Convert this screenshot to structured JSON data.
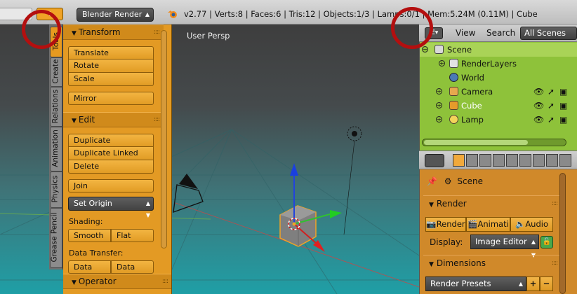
{
  "topbar": {
    "render_engine": "Blender Render",
    "stats": "v2.77 | Verts:8 | Faces:6 | Tris:12 | Objects:1/3 | Lamps:0/1 | Mem:5.24M (0.11M) | Cube",
    "add_label": "+"
  },
  "viewport": {
    "view_label": "User Persp"
  },
  "tool_tabs": [
    "Tools",
    "Create",
    "Relations",
    "Animation",
    "Physics",
    "Grease Pencil"
  ],
  "tool_panel": {
    "transform_header": "Transform",
    "transform_buttons": [
      "Translate",
      "Rotate",
      "Scale"
    ],
    "mirror": "Mirror",
    "edit_header": "Edit",
    "edit_buttons": [
      "Duplicate",
      "Duplicate Linked",
      "Delete"
    ],
    "join": "Join",
    "set_origin": "Set Origin",
    "shading_label": "Shading:",
    "smooth": "Smooth",
    "flat": "Flat",
    "data_transfer_label": "Data Transfer:",
    "data": "Data",
    "data_layout": "Data Layo",
    "operator_header": "Operator"
  },
  "outliner": {
    "menu_view": "View",
    "menu_search": "Search",
    "scenes_dropdown": "All Scenes",
    "items": {
      "scene": "Scene",
      "render_layers": "RenderLayers",
      "world": "World",
      "camera": "Camera",
      "cube": "Cube",
      "lamp": "Lamp"
    }
  },
  "properties": {
    "scene_label": "Scene",
    "render_header": "Render",
    "render_btn": "Render",
    "animation_btn": "Animati",
    "audio_btn": "Audio",
    "display_label": "Display:",
    "display_value": "Image Editor",
    "dimensions_header": "Dimensions",
    "presets_value": "Render Presets"
  },
  "colors": {
    "panel_orange": "#e39a24",
    "outliner_green": "#8ec23a",
    "annotation_red": "#b40f0f",
    "cube_selected": "#f0a326"
  }
}
